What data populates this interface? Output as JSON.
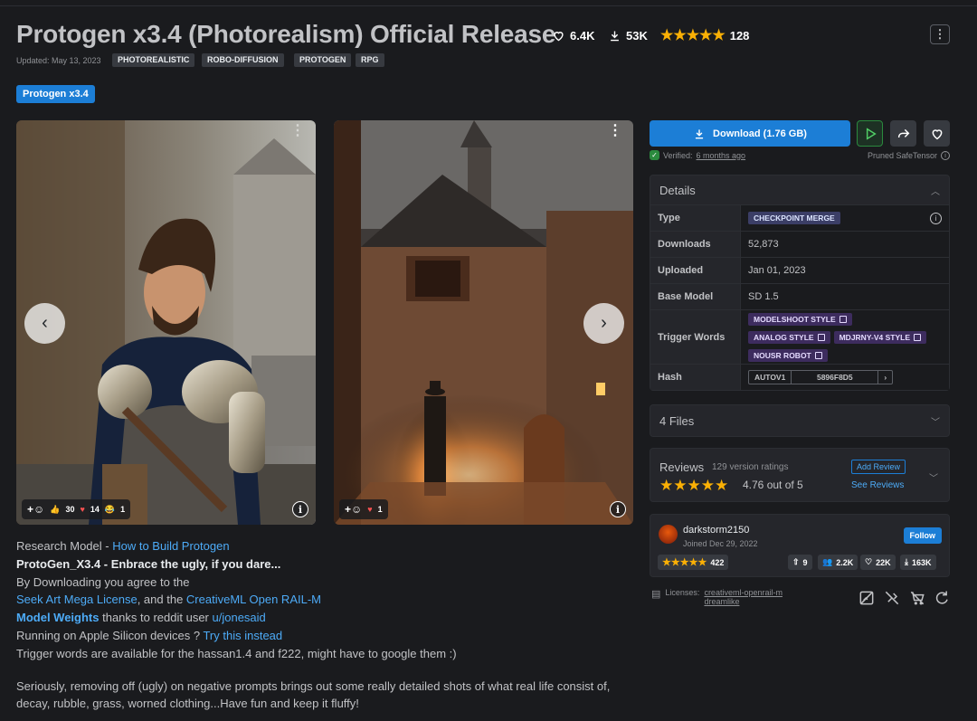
{
  "header": {
    "title": "Protogen x3.4 (Photorealism) Official Release",
    "likes": "6.4K",
    "downloads": "53K",
    "rating_count": "128",
    "updated": "Updated: May 13, 2023",
    "tags": [
      "PHOTOREALISTIC",
      "ROBO-DIFFUSION",
      "PROTOGEN",
      "RPG"
    ],
    "version": "Protogen x3.4"
  },
  "gallery": {
    "card1": {
      "reactions": {
        "thumbs": "30",
        "hearts": "14",
        "laugh": "1"
      }
    },
    "card2": {
      "reactions": {
        "hearts": "1"
      }
    }
  },
  "description": {
    "line1_prefix": "Research Model - ",
    "line1_link": "How to Build Protogen",
    "line2": "ProtoGen_X3.4 - Enbrace the ugly, if you dare...",
    "line3": "By Downloading you agree to the",
    "line4_link1": "Seek Art Mega License",
    "line4_mid": ", and the ",
    "line4_link2": "CreativeML Open RAIL-M",
    "line5_link1": "Model Weights",
    "line5_mid": " thanks to reddit user ",
    "line5_link2": "u/jonesaid",
    "line6_prefix": "Running on Apple Silicon devices ? ",
    "line6_link": "Try this instead",
    "line7": "Trigger words are available for the hassan1.4 and f222, might have to google them :)",
    "para2": "Seriously, removing off (ugly) on negative prompts brings out some really detailed shots of what real life consist of, decay, rubble, grass, worned clothing...Have fun and keep it fluffy!"
  },
  "sidebar": {
    "download_label": "Download (1.76 GB)",
    "verified_prefix": "Verified: ",
    "verified_when": "6 months ago",
    "pruned": "Pruned SafeTensor",
    "details": {
      "title": "Details",
      "type_label": "Type",
      "type_value": "CHECKPOINT MERGE",
      "downloads_label": "Downloads",
      "downloads_value": "52,873",
      "uploaded_label": "Uploaded",
      "uploaded_value": "Jan 01, 2023",
      "base_label": "Base Model",
      "base_value": "SD 1.5",
      "trigger_label": "Trigger Words",
      "triggers": [
        "MODELSHOOT STYLE",
        "ANALOG STYLE",
        "MDJRNY-V4 STYLE",
        "NOUSR ROBOT"
      ],
      "hash_label": "Hash",
      "hash_algo": "AUTOV1",
      "hash_value": "5896F8D5"
    },
    "files": {
      "title": "4 Files"
    },
    "reviews": {
      "title": "Reviews",
      "count_text": "129 version ratings",
      "score": "4.76 out of 5",
      "add_label": "Add Review",
      "see_label": "See Reviews"
    },
    "creator": {
      "name": "darkstorm2150",
      "joined": "Joined Dec 29, 2022",
      "follow_label": "Follow",
      "rating": "422",
      "uploads": "9",
      "followers": "2.2K",
      "likes": "22K",
      "downloads": "163K"
    },
    "licenses": {
      "label": "Licenses:",
      "link1": "creativeml-openrail-m",
      "link2": "dreamlike"
    }
  },
  "colors": {
    "accent": "#1c7ed6",
    "star": "#fab005",
    "bg": "#1a1b1e",
    "panel": "#25262b"
  }
}
